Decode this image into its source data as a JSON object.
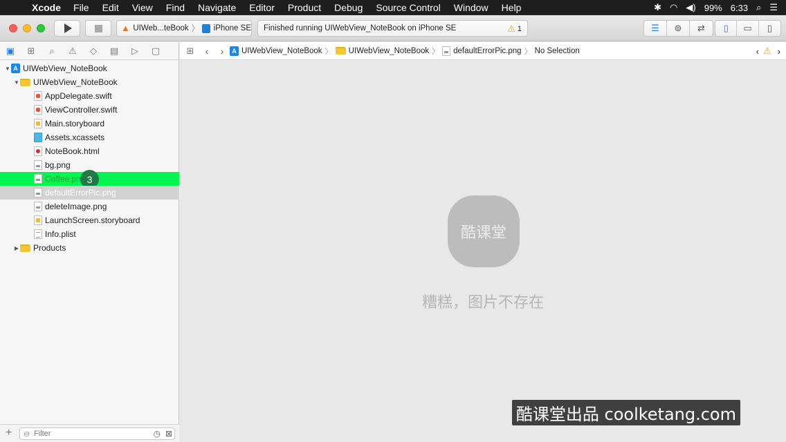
{
  "menubar": {
    "apple": "",
    "app_name": "Xcode",
    "items": [
      "File",
      "Edit",
      "View",
      "Find",
      "Navigate",
      "Editor",
      "Product",
      "Debug",
      "Source Control",
      "Window",
      "Help"
    ],
    "status": {
      "bluetooth": "✱",
      "wifi": "◠",
      "volume": "◀)",
      "battery": "99%",
      "time": "6:33",
      "search": "⌕",
      "menu": "☰"
    }
  },
  "toolbar": {
    "scheme_target": "UIWeb...teBook",
    "scheme_device": "iPhone SE",
    "activity_text": "Finished running UIWebView_NoteBook on iPhone SE",
    "warning_count": "1"
  },
  "tree": {
    "project": "UIWebView_NoteBook",
    "group": "UIWebView_NoteBook",
    "files": [
      {
        "name": "AppDelegate.swift",
        "type": "swift"
      },
      {
        "name": "ViewController.swift",
        "type": "swift"
      },
      {
        "name": "Main.storyboard",
        "type": "story"
      },
      {
        "name": "Assets.xcassets",
        "type": "assets"
      },
      {
        "name": "NoteBook.html",
        "type": "html"
      },
      {
        "name": "bg.png",
        "type": "png"
      },
      {
        "name": "Coffee.png",
        "type": "png"
      },
      {
        "name": "defaultErrorPic.png",
        "type": "png"
      },
      {
        "name": "deleteImage.png",
        "type": "png"
      },
      {
        "name": "LaunchScreen.storyboard",
        "type": "story"
      },
      {
        "name": "Info.plist",
        "type": "plist"
      }
    ],
    "products": "Products",
    "step_badge": "3"
  },
  "filter": {
    "placeholder": "Filter"
  },
  "jumpbar": {
    "crumbs": [
      "UIWebView_NoteBook",
      "UIWebView_NoteBook",
      "defaultErrorPic.png",
      "No Selection"
    ]
  },
  "editor": {
    "logo_text": "酷课堂",
    "message": "糟糕，图片不存在"
  },
  "watermark": "酷课堂出品 coolketang.com"
}
